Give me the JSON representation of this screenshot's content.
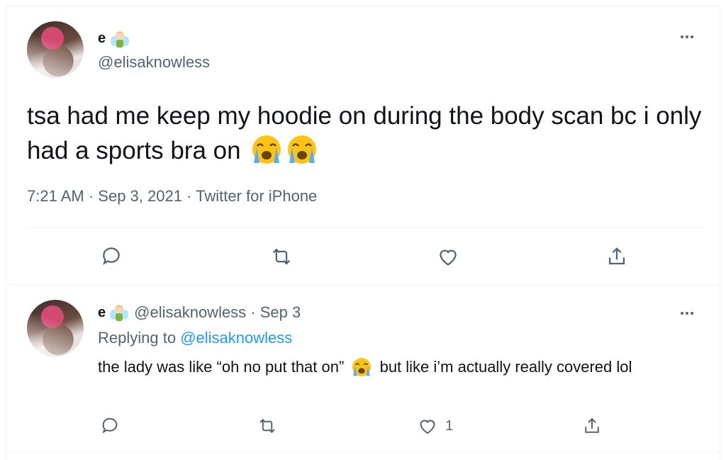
{
  "tweet": {
    "author_name": "e",
    "author_emoji": "man-fairy-emoji",
    "handle": "@elisaknowless",
    "text": "tsa had me keep my hoodie on during the body scan bc i only had a sports bra on",
    "text_emojis": [
      "loudly-crying-face-emoji",
      "loudly-crying-face-emoji"
    ],
    "time": "7:21 AM",
    "sep1": " · ",
    "date": "Sep 3, 2021",
    "sep2": " · ",
    "source": "Twitter for iPhone",
    "actions": [
      "reply-icon",
      "retweet-icon",
      "like-icon",
      "share-icon"
    ]
  },
  "reply": {
    "author_name": "e",
    "handle": "@elisaknowless",
    "date_prefix": " · ",
    "date": "Sep 3",
    "replying_label": "Replying to ",
    "replying_handle": "@elisaknowless",
    "text_part1": "the lady was like “oh no put that on”",
    "text_part2": "but like i’m actually really covered lol",
    "like_count": "1"
  },
  "colors": {
    "text": "#0f1419",
    "secondary": "#536471",
    "link": "#1d9bf0",
    "divider": "#eff3f4"
  }
}
